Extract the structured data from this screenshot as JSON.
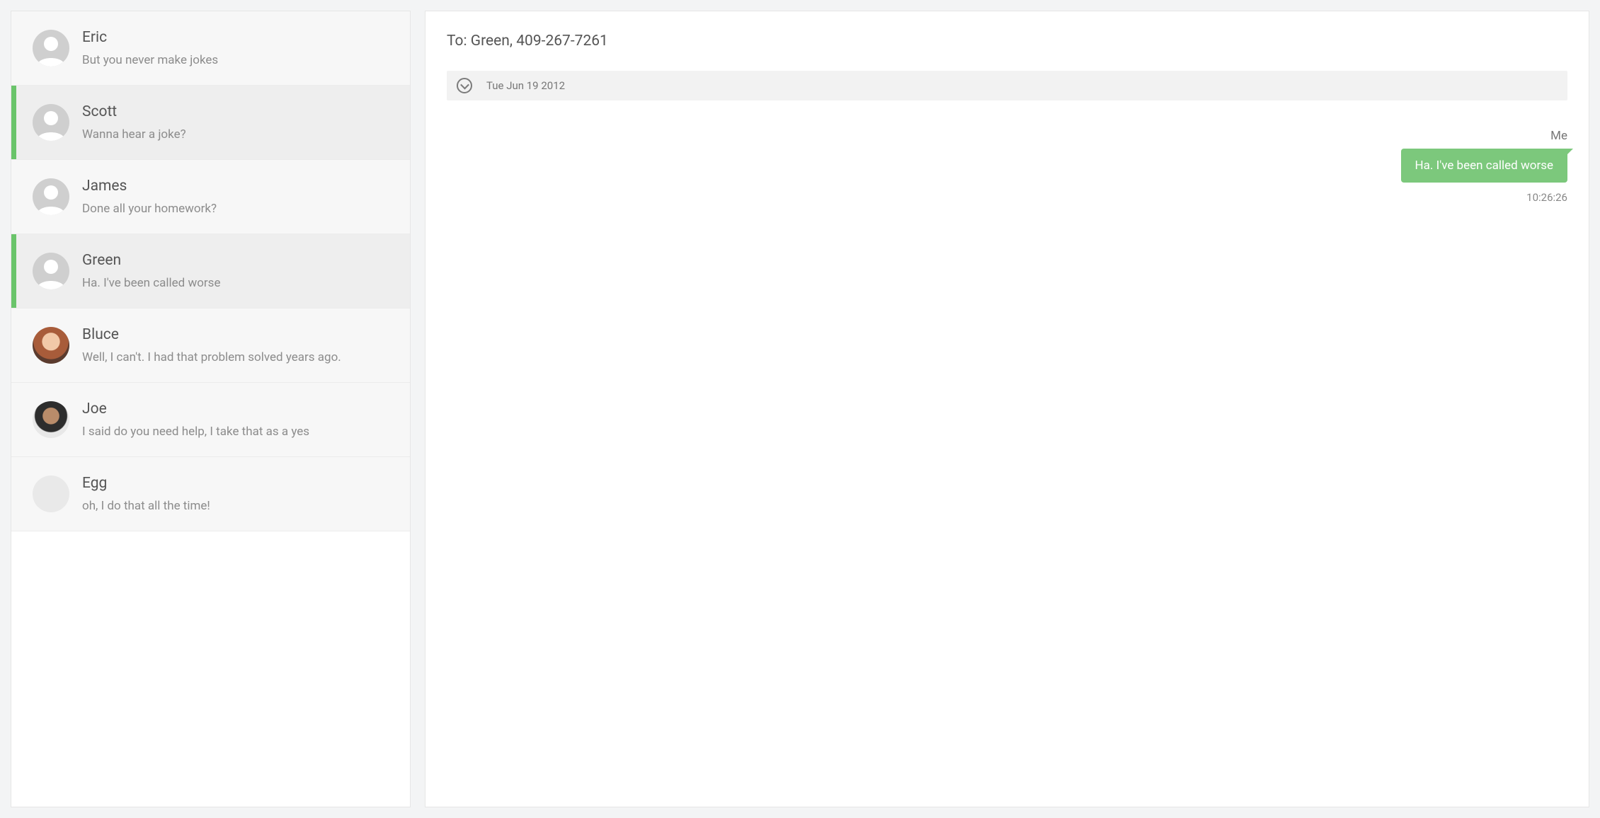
{
  "sidebar": {
    "conversations": [
      {
        "name": "Eric",
        "preview": "But you never make jokes",
        "active": false,
        "avatar": "generic"
      },
      {
        "name": "Scott",
        "preview": "Wanna hear a joke?",
        "active": true,
        "avatar": "generic"
      },
      {
        "name": "James",
        "preview": "Done all your homework?",
        "active": false,
        "avatar": "generic"
      },
      {
        "name": "Green",
        "preview": "Ha. I've been called worse",
        "active": true,
        "avatar": "generic"
      },
      {
        "name": "Bluce",
        "preview": "Well, I can't. I had that problem solved years ago.",
        "active": false,
        "avatar": "photo1"
      },
      {
        "name": "Joe",
        "preview": "I said do you need help, I take that as a yes",
        "active": false,
        "avatar": "photo2"
      },
      {
        "name": "Egg",
        "preview": "oh, I do that all the time!",
        "active": false,
        "avatar": "blank"
      }
    ]
  },
  "header": {
    "to_prefix": "To: ",
    "to_value": "Green, 409-267-7261"
  },
  "date_bar": {
    "text": "Tue Jun 19 2012"
  },
  "messages": [
    {
      "sender": "Me",
      "text": "Ha. I've been called worse",
      "time": "10:26:26",
      "outgoing": true
    }
  ],
  "colors": {
    "accent_green": "#7cc87c",
    "active_bar": "#6ac46a"
  }
}
